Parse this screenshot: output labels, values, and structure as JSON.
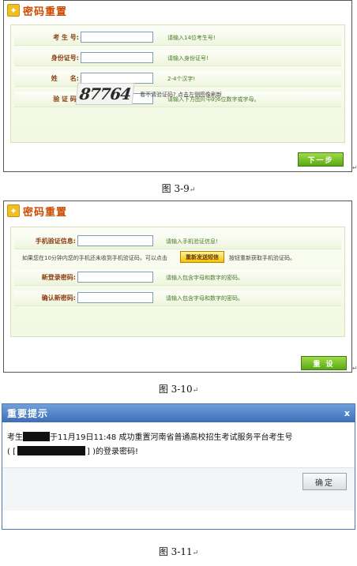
{
  "panel1": {
    "title": "密码重置",
    "fields": [
      {
        "label": "考 生 号:",
        "hint": "请输入14位考生号!"
      },
      {
        "label": "身份证号:",
        "hint": "请输入身份证号!"
      },
      {
        "label": "姓　　名:",
        "hint": "2-4个汉字!"
      },
      {
        "label": "验 证 码:",
        "hint": "请输入下方图片中的6位数字或字母。"
      }
    ],
    "captcha_text": "87764",
    "captcha_note": "看不清验证码? 点击左侧图像刷新",
    "next_button": "下一步",
    "caption": "图 3-9"
  },
  "panel2": {
    "title": "密码重置",
    "sms_label": "手机验证信息:",
    "sms_hint": "请输入手机验证信息!",
    "resend_note_before": "如果您在10分钟内您的手机还未收到手机验证码，可以点击",
    "resend_button": "重新发送短信",
    "resend_note_after": "按钮重新获取手机验证码。",
    "new_pwd_label": "新登录密码:",
    "new_pwd_hint": "请输入包含字母和数字的密码。",
    "confirm_pwd_label": "确认新密码:",
    "confirm_pwd_hint": "请输入包含字母和数字的密码。",
    "reset_button": "重 设",
    "caption": "图 3-10"
  },
  "dialog": {
    "title": "重要提示",
    "close": "x",
    "line1_prefix": "考生",
    "line1_suffix": "于11月19日11:48 成功重置河南省普通高校招生考试服务平台考生号",
    "line2_prefix": "( [",
    "line2_suffix": "] )的登录密码!",
    "ok_button": "确定",
    "caption": "图 3-11"
  },
  "marks": {
    "arrow": "↵",
    "paragraph": "↵"
  }
}
